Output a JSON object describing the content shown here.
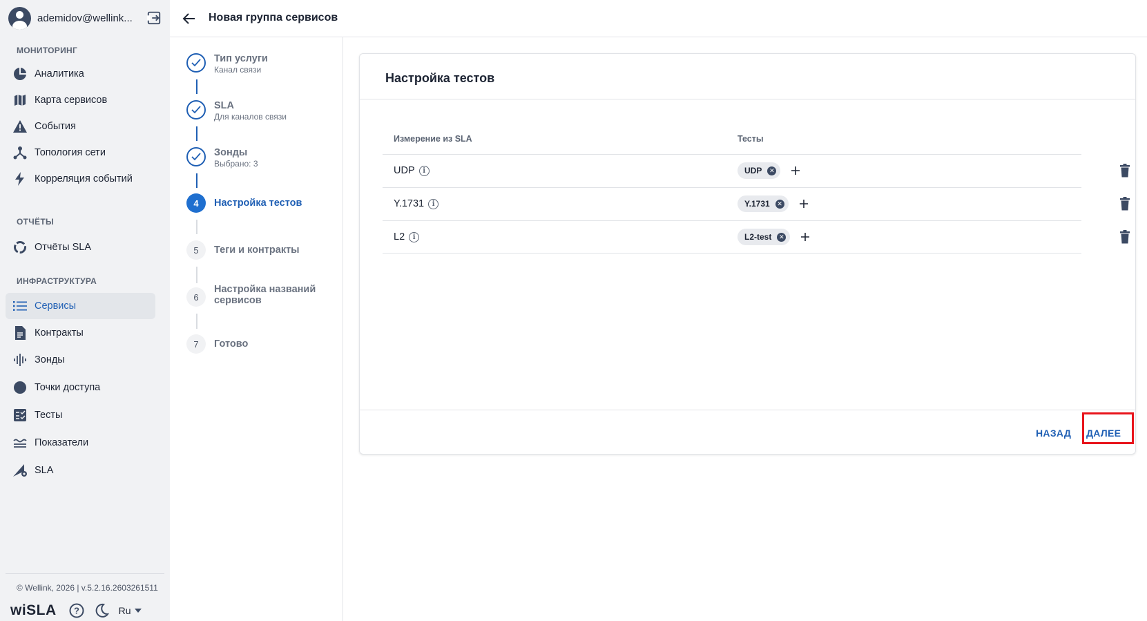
{
  "user": {
    "name": "ademidov@wellink..."
  },
  "sidebar": {
    "sections": [
      {
        "title": "МОНИТОРИНГ"
      },
      {
        "title": "ОТЧЁТЫ"
      },
      {
        "title": "ИНФРАСТРУКТУРА"
      }
    ],
    "items": [
      {
        "label": "Аналитика",
        "icon": "pie-chart-icon"
      },
      {
        "label": "Карта сервисов",
        "icon": "map-icon"
      },
      {
        "label": "События",
        "icon": "warning-icon"
      },
      {
        "label": "Топология сети",
        "icon": "topology-icon"
      },
      {
        "label": "Корреляция событий",
        "icon": "lightning-icon"
      },
      {
        "label": "Отчёты SLA",
        "icon": "circle-progress-icon"
      },
      {
        "label": "Сервисы",
        "icon": "list-icon",
        "active": true
      },
      {
        "label": "Контракты",
        "icon": "document-icon"
      },
      {
        "label": "Зонды",
        "icon": "waveform-icon"
      },
      {
        "label": "Точки доступа",
        "icon": "circle-icon"
      },
      {
        "label": "Тесты",
        "icon": "checklist-icon"
      },
      {
        "label": "Показатели",
        "icon": "metrics-icon"
      },
      {
        "label": "SLA",
        "icon": "sla-gear-icon"
      }
    ],
    "copyright": "© Wellink, 2026 | v.5.2.16.2603261511",
    "brand": "wiSLA",
    "language": "Ru"
  },
  "header": {
    "title": "Новая группа сервисов"
  },
  "stepper": {
    "steps": [
      {
        "number": "1",
        "title": "Тип услуги",
        "subtitle": "Канал связи",
        "state": "done"
      },
      {
        "number": "2",
        "title": "SLA",
        "subtitle": "Для каналов связи",
        "state": "done"
      },
      {
        "number": "3",
        "title": "Зонды",
        "subtitle": "Выбрано: 3",
        "state": "done"
      },
      {
        "number": "4",
        "title": "Настройка тестов",
        "subtitle": "",
        "state": "current"
      },
      {
        "number": "5",
        "title": "Теги и контракты",
        "subtitle": "",
        "state": "todo"
      },
      {
        "number": "6",
        "title": "Настройка названий",
        "title2": "сервисов",
        "subtitle": "",
        "state": "todo"
      },
      {
        "number": "7",
        "title": "Готово",
        "subtitle": "",
        "state": "todo"
      }
    ]
  },
  "card": {
    "title": "Настройка тестов",
    "columns": {
      "measurement": "Измерение из SLA",
      "tests": "Тесты"
    },
    "rows": [
      {
        "name": "UDP",
        "chip": "UDP"
      },
      {
        "name": "Y.1731",
        "chip": "Y.1731"
      },
      {
        "name": "L2",
        "chip": "L2-test"
      }
    ],
    "back_label": "НАЗАД",
    "next_label": "ДАЛЕЕ"
  },
  "colors": {
    "accent": "#1f5fb4",
    "highlight": "#e8141b",
    "sidebar_bg": "#f1f2f4"
  }
}
